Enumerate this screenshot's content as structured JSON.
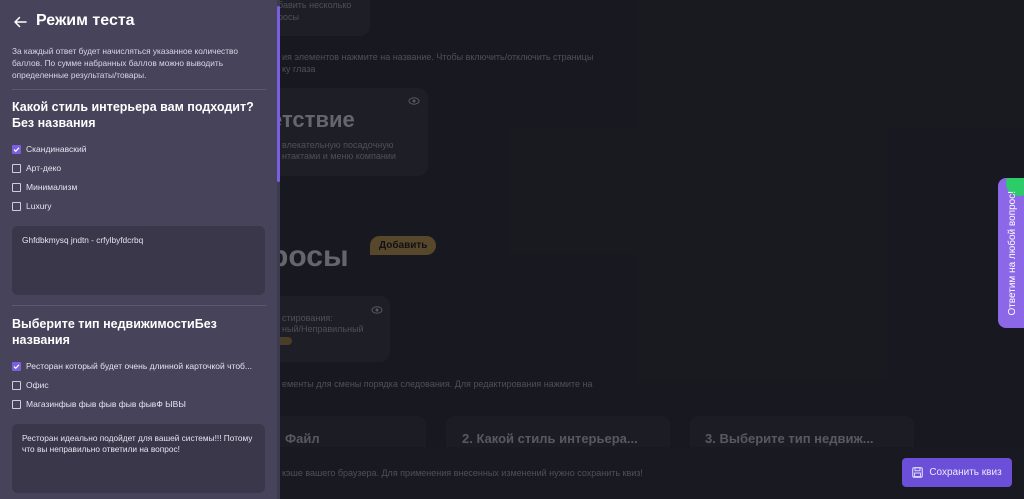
{
  "panel": {
    "title": "Режим теста",
    "description": "За каждый ответ будет начисляться указанное количество баллов. По сумме набранных баллов можно выводить определенные результаты/товары.",
    "questions": [
      {
        "title": "Какой стиль интерьера вам подходит?Без названия",
        "options": [
          {
            "label": "Скандинавский",
            "checked": true
          },
          {
            "label": "Арт-деко",
            "checked": false
          },
          {
            "label": "Минимализм",
            "checked": false
          },
          {
            "label": "Luxury",
            "checked": false
          }
        ],
        "answer_text": "Ghfdbkmysq jndtn - crfylbyfdcrbq"
      },
      {
        "title": "Выберите тип недвижимостиБез названия",
        "options": [
          {
            "label": "Ресторан который будет очень длинной карточкой чтоб...",
            "checked": true
          },
          {
            "label": "Офис",
            "checked": false
          },
          {
            "label": "Магазинфыв фыв фыв фыв фывФ ЫВЫ",
            "checked": false
          }
        ],
        "answer_text": "Ресторан идеально подойдет для вашей системы!!! Потому что вы неправильно ответили на вопрос!"
      }
    ]
  },
  "background": {
    "top_card_text": [
      "бавить несколько",
      "росы"
    ],
    "hint_line_1": "ия элементов нажмите на название. Чтобы включить/отключить страницы",
    "hint_line_2": "ку глаза",
    "welcome_title": "етствие",
    "welcome_desc_1": "влекательную посадочную",
    "welcome_desc_2": "нтактами и меню компании",
    "questions_title": "росы",
    "add_button": "Добавить",
    "q_card_desc_1": "стирования:",
    "q_card_desc_2": "ный/Неправильный",
    "order_hint": "ементы для смены порядка следования. Для редактирования нажмите на",
    "steps": [
      "Файл",
      "2. Какой стиль интерьера...",
      "3. Выберите тип недвиж..."
    ],
    "cache_notice": "кэше вашего браузера. Для применения внесенных изменений нужно сохранить квиз!",
    "save_button": "Сохранить квиз",
    "side_tab": "Ответим на любой вопрос!"
  },
  "colors": {
    "accent": "#7b5fe0",
    "panel_bg": "#46435a",
    "badge_gold": "#b6934e",
    "side_tab": "#8c68e8",
    "online_dot": "#2ccd68"
  }
}
